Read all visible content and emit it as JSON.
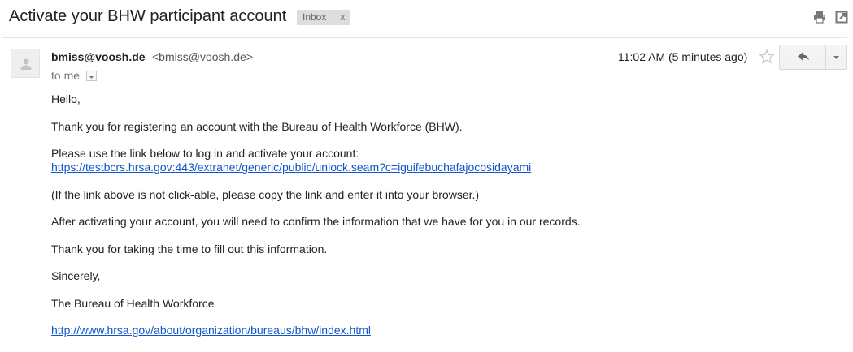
{
  "email": {
    "subject": "Activate your BHW participant account",
    "label": "Inbox",
    "label_remove": "x",
    "sender": {
      "name": "bmiss@voosh.de",
      "email": "<bmiss@voosh.de>"
    },
    "recipient": "to me",
    "timestamp": "11:02 AM (5 minutes ago)",
    "body": {
      "greeting": "Hello,",
      "line1": "Thank you for registering an account with the Bureau of Health Workforce (BHW).",
      "line2": "Please use the link below to log in and activate your account:",
      "activation_link": "https://testbcrs.hrsa.gov:443/extranet/generic/public/unlock.seam?c=iguifebuchafajocosidayami",
      "line3": "(If the link above is not click-able, please copy the link and enter it into your browser.)",
      "line4": "After activating your account, you will need to confirm the information that we have for you in our records.",
      "line5": "Thank you for taking the time to fill out this information.",
      "closing": "Sincerely,",
      "signature": "The Bureau of Health Workforce",
      "signature_link": "http://www.hrsa.gov/about/organization/bureaus/bhw/index.html"
    }
  },
  "icons": {
    "print": "print-icon",
    "popout": "new-window-icon",
    "avatar": "person-icon",
    "star": "star-icon",
    "reply": "reply-icon",
    "more": "caret-down-icon",
    "recipient_details": "caret-down-icon"
  },
  "colors": {
    "link": "#1155cc",
    "label_bg": "#dddddd",
    "star": "#cccccc"
  }
}
